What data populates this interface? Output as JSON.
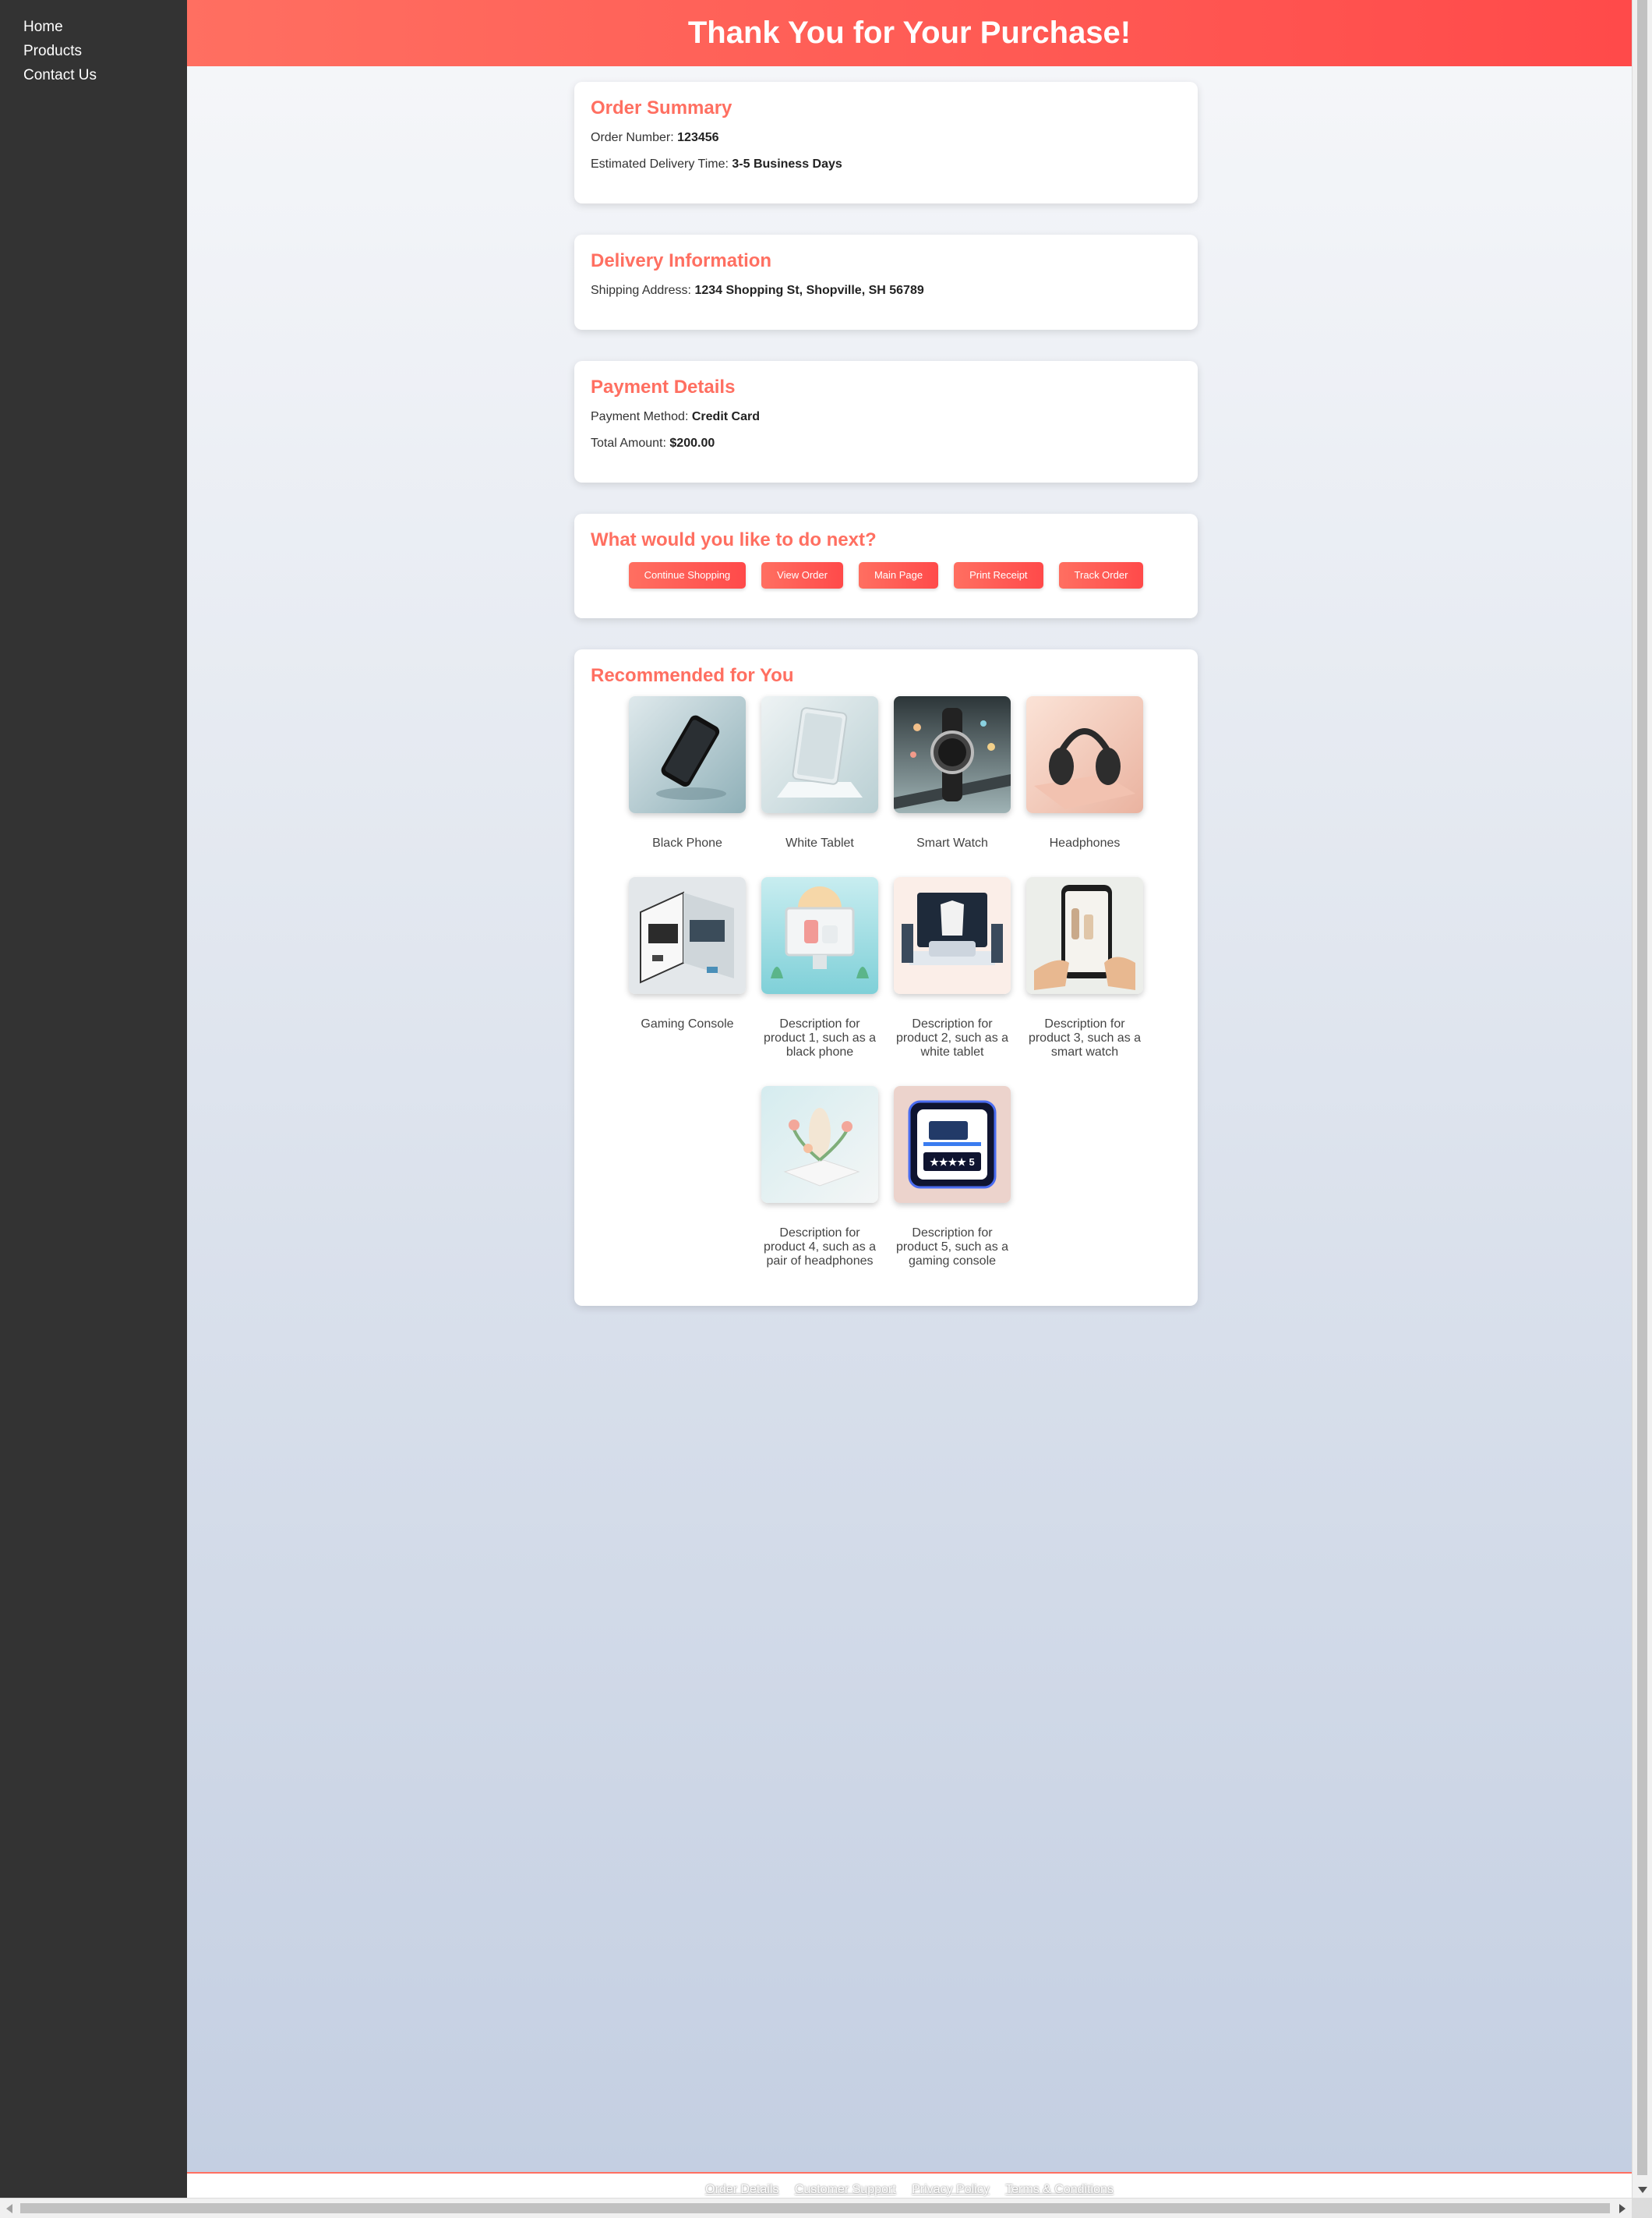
{
  "sidebar": {
    "items": [
      {
        "label": "Home"
      },
      {
        "label": "Products"
      },
      {
        "label": "Contact Us"
      }
    ]
  },
  "banner": {
    "title": "Thank You for Your Purchase!"
  },
  "order_summary": {
    "heading": "Order Summary",
    "order_number_label": "Order Number:",
    "order_number": "123456",
    "delivery_time_label": "Estimated Delivery Time:",
    "delivery_time": "3-5 Business Days"
  },
  "delivery_info": {
    "heading": "Delivery Information",
    "address_label": "Shipping Address:",
    "address": "1234 Shopping St, Shopville, SH 56789"
  },
  "payment": {
    "heading": "Payment Details",
    "method_label": "Payment Method:",
    "method": "Credit Card",
    "total_label": "Total Amount:",
    "total": "$200.00"
  },
  "next_steps": {
    "heading": "What would you like to do next?",
    "buttons": [
      {
        "label": "Continue Shopping"
      },
      {
        "label": "View Order"
      },
      {
        "label": "Main Page"
      },
      {
        "label": "Print Receipt"
      },
      {
        "label": "Track Order"
      }
    ]
  },
  "recommended": {
    "heading": "Recommended for You",
    "products": [
      {
        "label": "Black Phone"
      },
      {
        "label": "White Tablet"
      },
      {
        "label": "Smart Watch"
      },
      {
        "label": "Headphones"
      },
      {
        "label": "Gaming Console"
      },
      {
        "label": "Description for product 1, such as a black phone"
      },
      {
        "label": "Description for product 2, such as a white tablet"
      },
      {
        "label": "Description for product 3, such as a smart watch"
      },
      {
        "label": "Description for product 4, such as a pair of headphones"
      },
      {
        "label": "Description for product 5, such as a gaming console"
      }
    ],
    "thumb_icons": [
      "phone-icon",
      "tablet-icon",
      "smartwatch-icon",
      "headphones-icon",
      "gaming-console-icon",
      "desktop-monitor-icon",
      "room-display-icon",
      "smartphone-hand-icon",
      "flower-vase-icon",
      "product-box-icon"
    ],
    "product5_image_text": "★★★★ 5"
  },
  "footer": {
    "links": [
      {
        "label": "Order Details"
      },
      {
        "label": "Customer Support"
      },
      {
        "label": "Privacy Policy"
      },
      {
        "label": "Terms & Conditions"
      }
    ]
  },
  "colors": {
    "accent": "#ff6f61",
    "accent_dark": "#ff4a4a",
    "sidebar_bg": "#333333"
  }
}
